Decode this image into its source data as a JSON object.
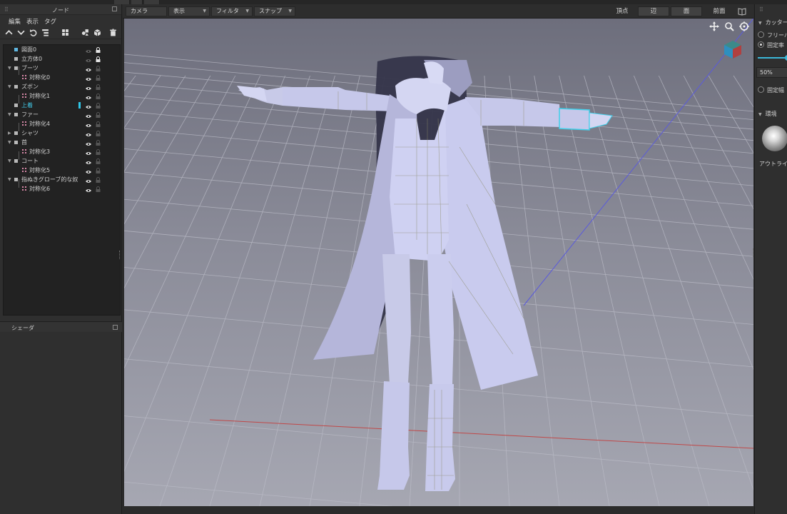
{
  "app": {
    "title": "ノード"
  },
  "top_strip": {
    "tabs": [
      "",
      "",
      ""
    ]
  },
  "node_panel": {
    "title": "ノード",
    "menu": [
      "編集",
      "表示",
      "タグ"
    ],
    "toolbar_icons": [
      "chevron-up-icon",
      "chevron-down-icon",
      "undo-icon",
      "list-icon",
      "grid-icon",
      "group-icon",
      "cube-icon",
      "trash-icon"
    ],
    "tree": [
      {
        "label": "図面0",
        "level": 0,
        "type": "drawing",
        "visible": false,
        "locked": true,
        "expandable": false
      },
      {
        "label": "立方体0",
        "level": 0,
        "type": "object",
        "visible": false,
        "locked": true,
        "expandable": false
      },
      {
        "label": "ブーツ",
        "level": 0,
        "type": "object",
        "visible": true,
        "locked": false,
        "expandable": true
      },
      {
        "label": "対称化0",
        "level": 1,
        "type": "symmetry",
        "visible": true,
        "locked": false,
        "expandable": false
      },
      {
        "label": "ズボン",
        "level": 0,
        "type": "object",
        "visible": true,
        "locked": false,
        "expandable": true
      },
      {
        "label": "対称化1",
        "level": 1,
        "type": "symmetry",
        "visible": true,
        "locked": false,
        "expandable": false
      },
      {
        "label": "上着",
        "level": 0,
        "type": "object",
        "visible": true,
        "locked": false,
        "expandable": false,
        "selected": true
      },
      {
        "label": "ファー",
        "level": 0,
        "type": "object",
        "visible": true,
        "locked": false,
        "expandable": true
      },
      {
        "label": "対称化4",
        "level": 1,
        "type": "symmetry",
        "visible": true,
        "locked": false,
        "expandable": false
      },
      {
        "label": "シャツ",
        "level": 0,
        "type": "object",
        "visible": true,
        "locked": false,
        "expandable": true,
        "collapsed": true
      },
      {
        "label": "首",
        "level": 0,
        "type": "object",
        "visible": true,
        "locked": false,
        "expandable": true
      },
      {
        "label": "対称化3",
        "level": 1,
        "type": "symmetry",
        "visible": true,
        "locked": false,
        "expandable": false
      },
      {
        "label": "コート",
        "level": 0,
        "type": "object",
        "visible": true,
        "locked": false,
        "expandable": true
      },
      {
        "label": "対称化5",
        "level": 1,
        "type": "symmetry",
        "visible": true,
        "locked": false,
        "expandable": false
      },
      {
        "label": "指ぬきグローブ的な奴",
        "level": 0,
        "type": "object",
        "visible": true,
        "locked": false,
        "expandable": true
      },
      {
        "label": "対称化6",
        "level": 1,
        "type": "symmetry",
        "visible": true,
        "locked": false,
        "expandable": false
      }
    ]
  },
  "shader_panel": {
    "title": "シェーダ"
  },
  "viewport_toolbar": {
    "dropdowns": [
      "カメラ",
      "表示",
      "フィルタ",
      "スナップ"
    ],
    "modes": [
      {
        "label": "頂点",
        "active": false
      },
      {
        "label": "辺",
        "active": true
      },
      {
        "label": "面",
        "active": true
      },
      {
        "label": "前面",
        "active": false
      }
    ]
  },
  "viewport": {
    "nav_icons": [
      "move-icon",
      "zoom-icon",
      "orbit-icon"
    ],
    "colors": {
      "model": "#c9cbee",
      "grid": "#b9bac6",
      "x_axis": "#c04848",
      "y_axis": "#5a5adc",
      "selection": "#3fd0ea"
    }
  },
  "right_panel": {
    "cutter_title": "カッター",
    "options": [
      {
        "label": "フリーハンド",
        "selected": false
      },
      {
        "label": "固定率",
        "selected": true
      },
      {
        "label": "固定幅",
        "selected": false
      }
    ],
    "ratio_value": "50%",
    "environment_title": "環境",
    "outline_label": "アウトライン"
  }
}
